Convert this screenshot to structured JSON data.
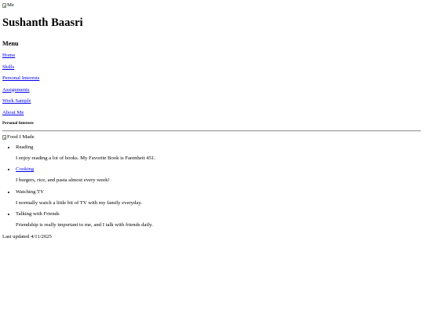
{
  "header": {
    "avatar_alt": "Me",
    "name": "Sushanth Baasri"
  },
  "menu": {
    "heading": "Menu",
    "items": [
      {
        "label": "Home"
      },
      {
        "label": "Skills"
      },
      {
        "label": "Personal Interests"
      },
      {
        "label": "Assignments"
      },
      {
        "label": "Work Sample"
      },
      {
        "label": "About Me"
      }
    ]
  },
  "section": {
    "heading": "Personal Interests",
    "image_alt": "Food I Made",
    "interests": [
      {
        "title": "Reading",
        "description": "I enjoy reading a lot of books. My Favorite Book is Farenheit 451."
      },
      {
        "title": "Cooking",
        "description": "I burgers, rice, and pasta almost every week!"
      },
      {
        "title": "Watching TV",
        "description": "I normally watch a little bit of TV with my family everyday."
      },
      {
        "title": "Talking with Friends",
        "description": "Friendship is really important to me, and I talk with friends daily."
      }
    ]
  },
  "footer": {
    "updated": "Last updated 4/11/2025"
  },
  "colors": {
    "link": "#0000ee",
    "text": "#000000",
    "background": "#ffffff"
  }
}
